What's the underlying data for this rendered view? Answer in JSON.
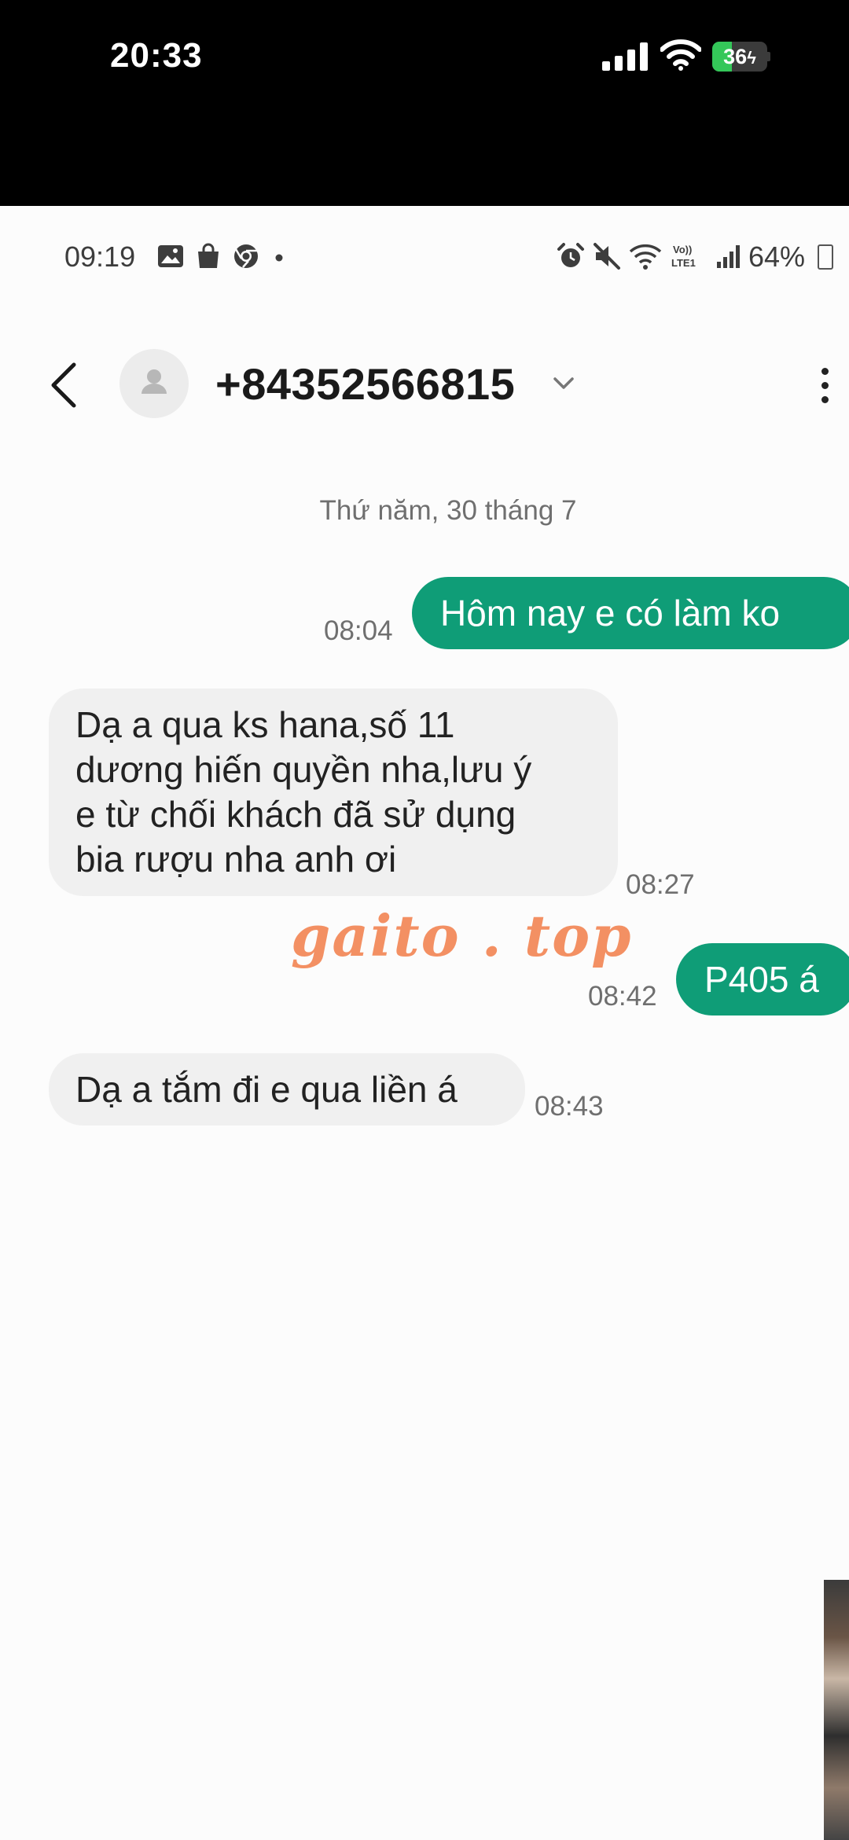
{
  "ios_status": {
    "time": "20:33",
    "battery": "36",
    "battery_level": 0.36
  },
  "android_status": {
    "time": "09:19",
    "battery": "64%",
    "network": "LTE1",
    "left_icons": [
      "gallery-icon",
      "shopping-bag-icon",
      "chrome-icon",
      "dot-icon"
    ],
    "right_icons": [
      "alarm-icon",
      "mute-icon",
      "wifi-call-icon",
      "volte-icon",
      "signal-icon"
    ]
  },
  "header": {
    "contact": "+84352566815"
  },
  "conversation": {
    "date": "Thứ năm, 30 tháng 7",
    "messages": [
      {
        "direction": "out",
        "text": "Hôm nay e có làm ko",
        "time": "08:04"
      },
      {
        "direction": "in",
        "lines": [
          "Dạ a qua ks hana,số 11",
          "dương hiến quyền nha,lưu ý",
          "e từ chối khách đã sử dụng",
          "bia rượu nha anh ơi"
        ],
        "time": "08:27"
      },
      {
        "direction": "out",
        "text": "P405 á",
        "time": "08:42"
      },
      {
        "direction": "in",
        "text": "Dạ a tắm đi e qua liền á",
        "time": "08:43"
      }
    ]
  },
  "watermark": "gaito . top",
  "colors": {
    "outgoing_bubble": "#0f9d77",
    "incoming_bubble": "#f0f0f0",
    "watermark": "#f39063"
  }
}
